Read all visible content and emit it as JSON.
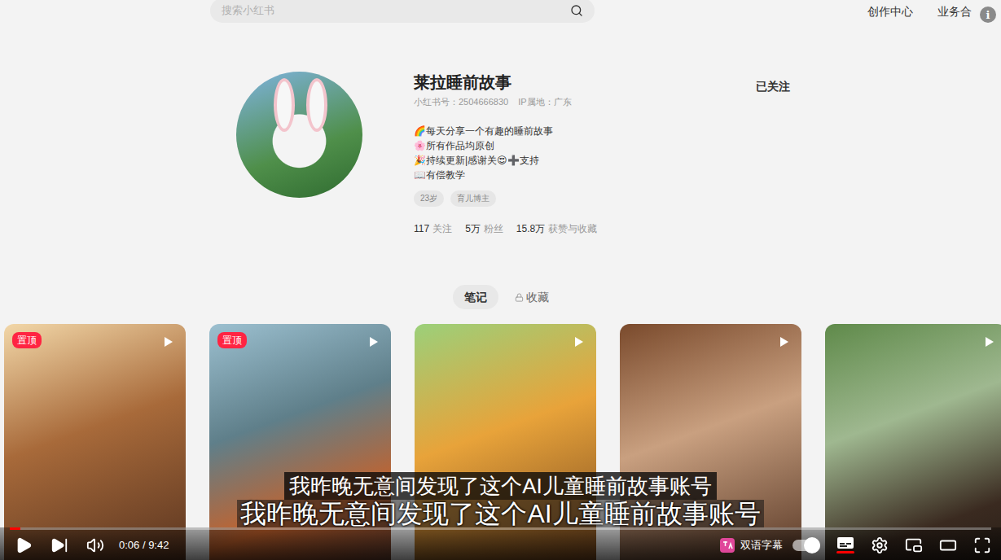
{
  "header": {
    "search_placeholder": "搜索小红书",
    "links": [
      "创作中心",
      "业务合"
    ],
    "info_icon": "i"
  },
  "profile": {
    "name": "莱拉睡前故事",
    "id_line": "小红书号：2504666830",
    "ip": "IP属地：广东",
    "bio": [
      "🌈每天分享一个有趣的睡前故事",
      "🌸所有作品均原创",
      "🎉持续更新|感谢关😍➕支持",
      "📖有偿教学"
    ],
    "tags": [
      "23岁",
      "育儿博主"
    ],
    "stats": [
      {
        "value": "117",
        "label": "关注"
      },
      {
        "value": "5万",
        "label": "粉丝"
      },
      {
        "value": "15.8万",
        "label": "获赞与收藏"
      }
    ],
    "follow_button": "已关注"
  },
  "tabs": [
    {
      "label": "笔记",
      "selected": true,
      "locked": false
    },
    {
      "label": "收藏",
      "selected": false,
      "locked": true
    }
  ],
  "notes": [
    {
      "pinned": true,
      "badge": "置顶"
    },
    {
      "pinned": true,
      "badge": "置顶"
    },
    {
      "pinned": false
    },
    {
      "pinned": false
    },
    {
      "pinned": false
    }
  ],
  "subtitles": [
    "我昨晚无意间发现了这个AI儿童睡前故事账号",
    "我昨晚无意间发现了这个AI儿童睡前故事账号"
  ],
  "player": {
    "time": "0:06 / 9:42",
    "progress": 0.0106,
    "playing": false,
    "captions_on": true,
    "bilingual_label": "双语字幕",
    "bilingual_on": true
  }
}
